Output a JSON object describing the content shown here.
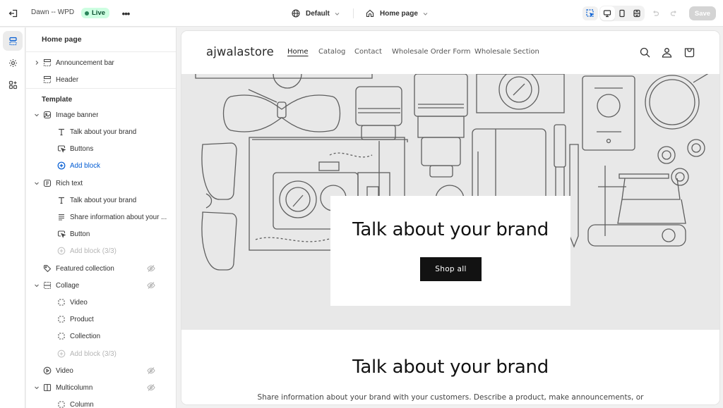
{
  "topbar": {
    "store_name": "Dawn -- WPD",
    "status_badge": "Live",
    "theme_selector": "Default",
    "page_selector": "Home page",
    "save_label": "Save",
    "colors": {
      "live_bg": "#cdfee1",
      "live_dot": "#29845a",
      "accent": "#005bd3"
    }
  },
  "sidebar": {
    "title": "Home page",
    "header_group": [
      {
        "label": "Announcement bar",
        "icon": "layout-header-icon",
        "expandable": true
      },
      {
        "label": "Header",
        "icon": "layout-header-icon",
        "expandable": false
      }
    ],
    "template_heading": "Template",
    "template": [
      {
        "label": "Image banner",
        "icon": "image-banner-icon",
        "level": 1,
        "expanded": true
      },
      {
        "label": "Talk about your brand",
        "icon": "text-icon",
        "level": 2
      },
      {
        "label": "Buttons",
        "icon": "button-pointer-icon",
        "level": 2
      },
      {
        "label": "Add block",
        "icon": "plus-circle-icon",
        "level": 2,
        "type": "add"
      },
      {
        "label": "Rich text",
        "icon": "rich-text-icon",
        "level": 1,
        "expanded": true
      },
      {
        "label": "Talk about your brand",
        "icon": "text-icon",
        "level": 2
      },
      {
        "label": "Share information about your ...",
        "icon": "paragraph-icon",
        "level": 2
      },
      {
        "label": "Button",
        "icon": "button-pointer-icon",
        "level": 2
      },
      {
        "label": "Add block (3/3)",
        "icon": "plus-circle-icon",
        "level": 2,
        "type": "disabled"
      },
      {
        "label": "Featured collection",
        "icon": "tag-icon",
        "level": 1,
        "hidden": true
      },
      {
        "label": "Collage",
        "icon": "collage-icon",
        "level": 1,
        "expanded": true,
        "hidden": true
      },
      {
        "label": "Video",
        "icon": "block-dashed-icon",
        "level": 2
      },
      {
        "label": "Product",
        "icon": "block-dashed-icon",
        "level": 2
      },
      {
        "label": "Collection",
        "icon": "block-dashed-icon",
        "level": 2
      },
      {
        "label": "Add block (3/3)",
        "icon": "plus-circle-icon",
        "level": 2,
        "type": "disabled"
      },
      {
        "label": "Video",
        "icon": "play-circle-icon",
        "level": 1,
        "hidden": true
      },
      {
        "label": "Multicolumn",
        "icon": "columns-icon",
        "level": 1,
        "expanded": true,
        "hidden": true
      },
      {
        "label": "Column",
        "icon": "block-dashed-icon",
        "level": 2
      }
    ]
  },
  "preview": {
    "store_logo": "ajwalastore",
    "nav": [
      "Home",
      "Catalog",
      "Contact",
      "Wholesale Order Form",
      "Wholesale Section"
    ],
    "active_nav": "Home",
    "banner": {
      "heading": "Talk about your brand",
      "button_label": "Shop all"
    },
    "rich_text": {
      "heading": "Talk about your brand",
      "body": "Share information about your brand with your customers. Describe a product, make announcements, or"
    }
  }
}
